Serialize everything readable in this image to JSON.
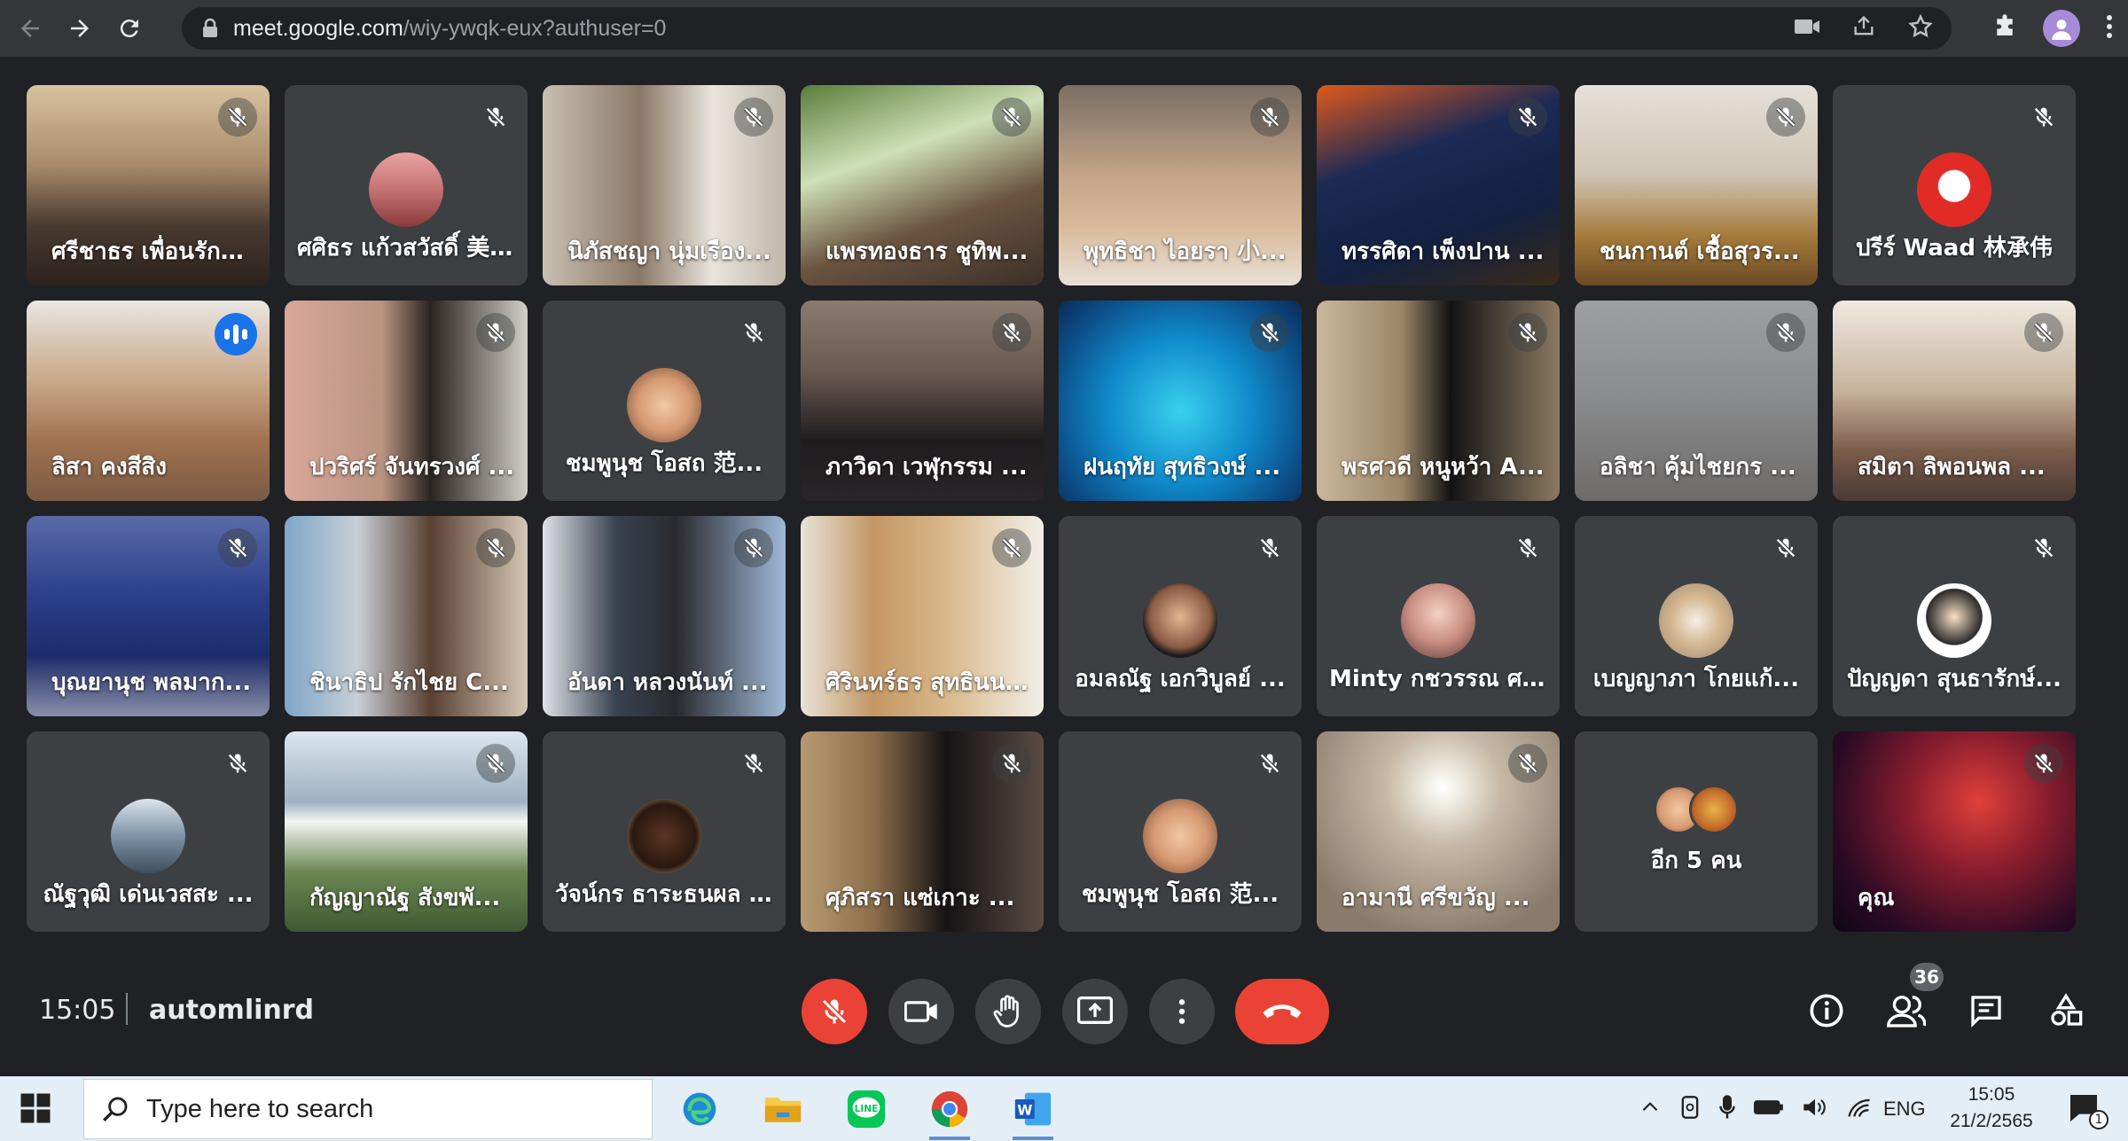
{
  "browser": {
    "url_host": "meet.google.com",
    "url_path": "/wiy-ywqk-eux?authuser=0"
  },
  "tiles": [
    {
      "name": "ศรีชาธร เพื่อนรักษ์ ...",
      "type": "video",
      "scene": "city"
    },
    {
      "name": "ศศิธร แก้วสวัสดิ์ 美...",
      "type": "avatar",
      "avatar": "sunset"
    },
    {
      "name": "นิภัสชญา นุ่มเรือง...",
      "type": "video",
      "scene": "face-mask"
    },
    {
      "name": "แพรทองธาร ชูทิพ...",
      "type": "video",
      "scene": "leaves-face"
    },
    {
      "name": "พุทธิชา ไอยรา 小...",
      "type": "video",
      "scene": "face"
    },
    {
      "name": "ทรรศิดา เพ็งปาน ...",
      "type": "video",
      "scene": "autumn"
    },
    {
      "name": "ชนกานต์ เชื้อสุวร...",
      "type": "video",
      "scene": "building"
    },
    {
      "name": "ปรีร์ Waad 林承伟",
      "type": "avatar",
      "avatar": "snoopy"
    },
    {
      "name": "ลิสา คงสีสิง",
      "type": "video",
      "scene": "girl",
      "speaking": true
    },
    {
      "name": "ปวริศร์ จันทรวงศ์ ...",
      "type": "video",
      "scene": "boy"
    },
    {
      "name": "ชมพูนุช โอสถ 范...",
      "type": "avatar",
      "avatar": "puppy"
    },
    {
      "name": "ภาวิดา เวฬุกรรม ...",
      "type": "video",
      "scene": "blackmask"
    },
    {
      "name": "ฝนฤทัย สุทธิวงษ์ ...",
      "type": "video",
      "scene": "aquarium"
    },
    {
      "name": "พรศวดี หนูหว้า A...",
      "type": "video",
      "scene": "room-hair"
    },
    {
      "name": "อลิชา คุ้มไชยกร ...",
      "type": "video",
      "scene": "grey"
    },
    {
      "name": "สมิตา ลิพอนพล ...",
      "type": "video",
      "scene": "forehead"
    },
    {
      "name": "บุณยานุช พลมาก...",
      "type": "video",
      "scene": "chair"
    },
    {
      "name": "ชินาธิป รักไชย C...",
      "type": "video",
      "scene": "boy2"
    },
    {
      "name": "อันดา หลวงนันท์ ...",
      "type": "video",
      "scene": "girl2"
    },
    {
      "name": "ศิรินทร์ธร สุทธินน...",
      "type": "video",
      "scene": "kitchen"
    },
    {
      "name": "อมลณัฐ เอกวิบูลย์ ...",
      "type": "avatar",
      "avatar": "glasses"
    },
    {
      "name": "Minty กชวรรณ ศรี...",
      "type": "avatar",
      "avatar": "selfie"
    },
    {
      "name": "เบญญาภา โกยแก้...",
      "type": "avatar",
      "avatar": "cat"
    },
    {
      "name": "ปัญญดา สุนธารักษ์...",
      "type": "avatar",
      "avatar": "cartoon"
    },
    {
      "name": "ณัฐวุฒิ เด่นเวสสะ ...",
      "type": "avatar",
      "avatar": "cloud"
    },
    {
      "name": "กัญญาณัฐ สังขพั...",
      "type": "video",
      "scene": "mountain"
    },
    {
      "name": "วัจน์กร ธาระธนผล ...",
      "type": "avatar",
      "avatar": "man"
    },
    {
      "name": "ศุภิสรา แซ่เกาะ ...",
      "type": "video",
      "scene": "poster"
    },
    {
      "name": "ชมพูนุช โอสถ 范...",
      "type": "avatar",
      "avatar": "puppy"
    },
    {
      "name": "อามานี ศรีขวัญ ...",
      "type": "video",
      "scene": "light"
    },
    {
      "name": "อีก 5 คน",
      "type": "more"
    },
    {
      "name": "คุณ",
      "type": "video",
      "scene": "nebula",
      "self": true
    }
  ],
  "meeting": {
    "time": "15:05",
    "code": "automlinrd",
    "participants_count": "36"
  },
  "taskbar": {
    "search_placeholder": "Type here to search",
    "lang": "ENG",
    "time": "15:05",
    "date": "21/2/2565",
    "notifications": "1"
  },
  "colors": {
    "meet_bg": "#202124",
    "tile_bg": "#3c4043",
    "red": "#ea4335",
    "blue_speaking": "#8ab4f8"
  }
}
